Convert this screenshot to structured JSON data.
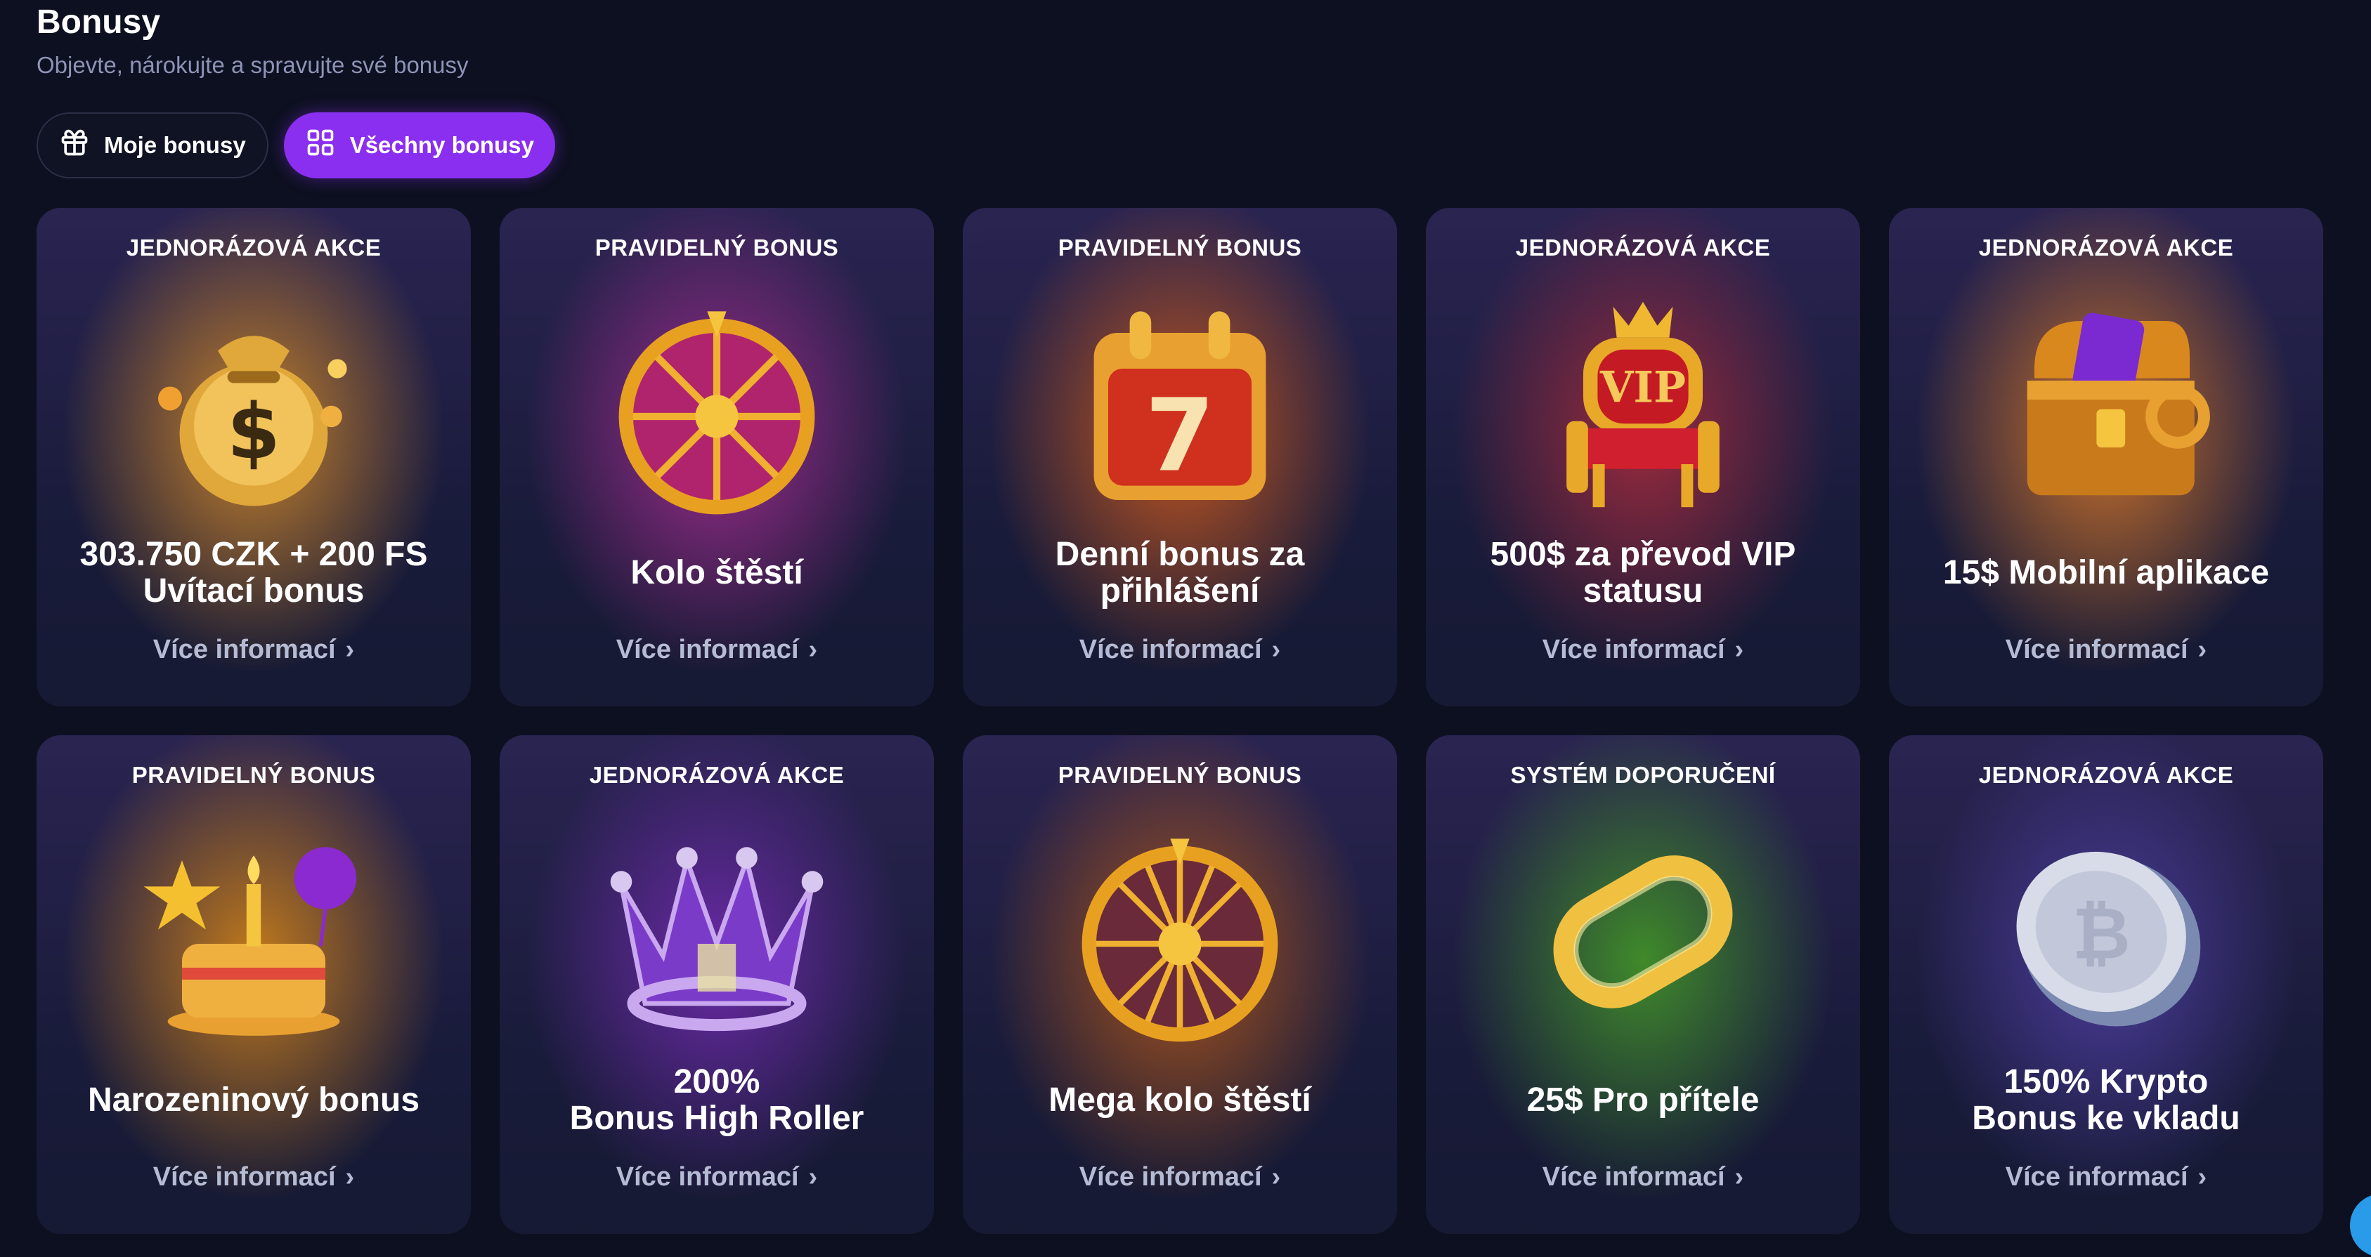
{
  "header": {
    "title": "Bonusy",
    "subtitle": "Objevte, nárokujte a spravujte své bonusy"
  },
  "tabs": [
    {
      "label": "Moje bonusy",
      "icon": "gift-icon",
      "active": false
    },
    {
      "label": "Všechny bonusy",
      "icon": "grid-icon",
      "active": true
    }
  ],
  "more_label": "Více informací",
  "cards": [
    {
      "tag": "JEDNORÁZOVÁ AKCE",
      "name": "303.750 CZK + 200 FS\nUvítací bonus",
      "icon": "money-bag-icon",
      "glow": "#c7822a"
    },
    {
      "tag": "PRAVIDELNÝ BONUS",
      "name": "Kolo štěstí",
      "icon": "fortune-wheel-icon",
      "glow": "#a02c8c"
    },
    {
      "tag": "PRAVIDELNÝ BONUS",
      "name": "Denní bonus za přihlášení",
      "icon": "calendar-icon",
      "glow": "#c4571e"
    },
    {
      "tag": "JEDNORÁZOVÁ AKCE",
      "name": "500$ za převod VIP\nstatusu",
      "icon": "vip-throne-icon",
      "glow": "#9a2a3c"
    },
    {
      "tag": "JEDNORÁZOVÁ AKCE",
      "name": "15$ Mobilní aplikace",
      "icon": "treasure-chest-icon",
      "glow": "#c9712a"
    },
    {
      "tag": "PRAVIDELNÝ BONUS",
      "name": "Narozeninový bonus",
      "icon": "birthday-cake-icon",
      "glow": "#c27a1c"
    },
    {
      "tag": "JEDNORÁZOVÁ AKCE",
      "name": "200%\nBonus High Roller",
      "icon": "crown-icon",
      "glow": "#6a2aa6"
    },
    {
      "tag": "PRAVIDELNÝ BONUS",
      "name": "Mega kolo štěstí",
      "icon": "fortune-wheel-icon",
      "glow": "#a8541c"
    },
    {
      "tag": "SYSTÉM DOPORUČENÍ",
      "name": "25$ Pro přítele",
      "icon": "chain-link-icon",
      "glow": "#3f8a2a"
    },
    {
      "tag": "JEDNORÁZOVÁ AKCE",
      "name": "150% Krypto\nBonus ke vkladu",
      "icon": "crypto-coin-icon",
      "glow": "#4a3c9a"
    }
  ]
}
